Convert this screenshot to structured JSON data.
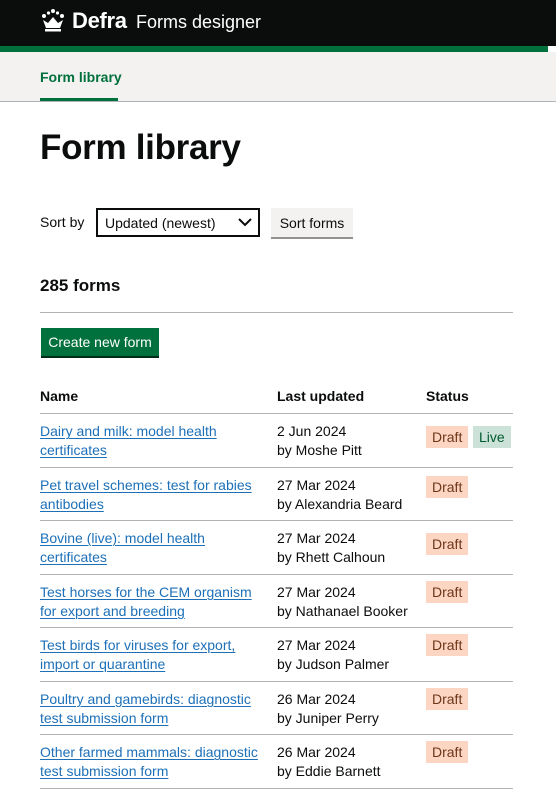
{
  "header": {
    "brand": "Defra",
    "service": "Forms designer",
    "crown_icon": "crown-icon"
  },
  "subnav": {
    "active_item": "Form library"
  },
  "page_title": "Form library",
  "sort": {
    "label": "Sort by",
    "selected": "Updated (newest)",
    "button_label": "Sort forms"
  },
  "form_count": "285 forms",
  "create_button": "Create new form",
  "table": {
    "headers": [
      "Name",
      "Last updated",
      "Status"
    ],
    "rows": [
      {
        "name": "Dairy and milk: model health certificates",
        "date": "2 Jun 2024",
        "by": "by Moshe Pitt",
        "statuses": [
          "Draft",
          "Live"
        ]
      },
      {
        "name": "Pet travel schemes: test for rabies antibodies",
        "date": "27 Mar 2024",
        "by": "by Alexandria Beard",
        "statuses": [
          "Draft"
        ]
      },
      {
        "name": "Bovine (live): model health certificates",
        "date": "27 Mar 2024",
        "by": "by Rhett Calhoun",
        "statuses": [
          "Draft"
        ]
      },
      {
        "name": "Test horses for the CEM organism for export and breeding",
        "date": "27 Mar 2024",
        "by": "by Nathanael Booker",
        "statuses": [
          "Draft"
        ]
      },
      {
        "name": "Test birds for viruses for export, import or quarantine",
        "date": "27 Mar 2024",
        "by": "by Judson Palmer",
        "statuses": [
          "Draft"
        ]
      },
      {
        "name": "Poultry and gamebirds: diagnostic test submission form",
        "date": "26 Mar 2024",
        "by": "by Juniper Perry",
        "statuses": [
          "Draft"
        ]
      },
      {
        "name": "Other farmed mammals: diagnostic test submission form",
        "date": "26 Mar 2024",
        "by": "by Eddie Barnett",
        "statuses": [
          "Draft"
        ]
      }
    ]
  },
  "colors": {
    "header_bg": "#0b0c0c",
    "brand_green": "#00703c",
    "link_blue": "#1d70b8",
    "draft_tag_bg": "#fcd6c3",
    "live_tag_bg": "#cce2d8"
  }
}
